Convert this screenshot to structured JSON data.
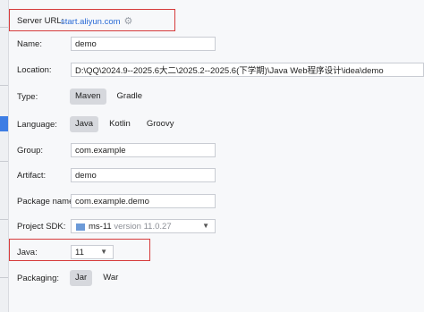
{
  "server": {
    "label": "Server URL:",
    "url": "start.aliyun.com"
  },
  "fields": {
    "name": {
      "label": "Name:",
      "value": "demo"
    },
    "location": {
      "label": "Location:",
      "value": "D:\\QQ\\2024.9--2025.6大二\\2025.2--2025.6(下学期)\\Java Web程序设计\\idea\\demo"
    },
    "group": {
      "label": "Group:",
      "value": "com.example"
    },
    "artifact": {
      "label": "Artifact:",
      "value": "demo"
    },
    "package_name": {
      "label": "Package name:",
      "value": "com.example.demo"
    }
  },
  "type": {
    "label": "Type:",
    "options": [
      "Maven",
      "Gradle"
    ],
    "selected": "Maven"
  },
  "language": {
    "label": "Language:",
    "options": [
      "Java",
      "Kotlin",
      "Groovy"
    ],
    "selected": "Java"
  },
  "sdk": {
    "label": "Project SDK:",
    "name": "ms-11",
    "version": "version 11.0.27"
  },
  "java": {
    "label": "Java:",
    "value": "11"
  },
  "packaging": {
    "label": "Packaging:",
    "options": [
      "Jar",
      "War"
    ],
    "selected": "Jar"
  },
  "colors": {
    "highlight": "#d63b3b",
    "link": "#2a6bd6"
  }
}
